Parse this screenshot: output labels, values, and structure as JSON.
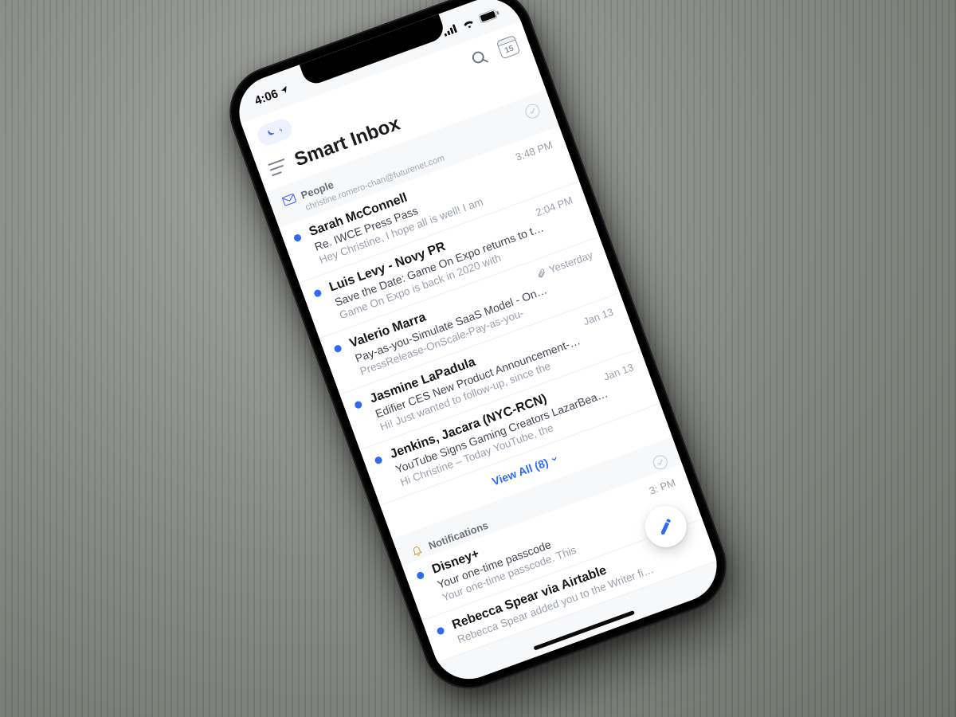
{
  "status": {
    "time": "4:06",
    "calendar_day": "15"
  },
  "app": {
    "title": "Smart Inbox"
  },
  "sections": {
    "people": {
      "label": "People",
      "account": "christine.romero-chan@futurenet.com",
      "view_all_label": "View All (8)",
      "rows": [
        {
          "sender": "Sarah McConnell",
          "subject": "Re. IWCE Press Pass",
          "preview": "Hey Christine, I hope all is well! I am",
          "time": "3:48 PM",
          "unread": true,
          "attachment": false
        },
        {
          "sender": "Luis Levy - Novy PR",
          "subject": "Save the Date: Game On Expo returns to t…",
          "preview": "Game On Expo is back in 2020 with",
          "time": "2:04 PM",
          "unread": true,
          "attachment": false
        },
        {
          "sender": "Valerio Marra",
          "subject": "Pay-as-you-Simulate SaaS Model - On…",
          "preview": "PressRelease-OnScale-Pay-as-you-",
          "time": "Yesterday",
          "unread": true,
          "attachment": true
        },
        {
          "sender": "Jasmine LaPadula",
          "subject": "Edifier CES New Product Announcement-…",
          "preview": "Hi! Just wanted to follow-up, since the",
          "time": "Jan 13",
          "unread": true,
          "attachment": false
        },
        {
          "sender": "Jenkins, Jacara (NYC-RCN)",
          "subject": "YouTube Signs Gaming Creators LazarBea…",
          "preview": "Hi Christine – Today YouTube, the",
          "time": "Jan 13",
          "unread": true,
          "attachment": false
        }
      ]
    },
    "notifications": {
      "label": "Notifications",
      "rows": [
        {
          "sender": "Disney+",
          "subject": "Your one-time passcode",
          "preview": "Your one-time passcode. This",
          "time": "3:  PM",
          "unread": true
        },
        {
          "sender": "Rebecca Spear via Airtable",
          "subject": "",
          "preview": "Rebecca Spear added you to the Writer fi…",
          "time": "",
          "unread": true
        }
      ]
    }
  }
}
